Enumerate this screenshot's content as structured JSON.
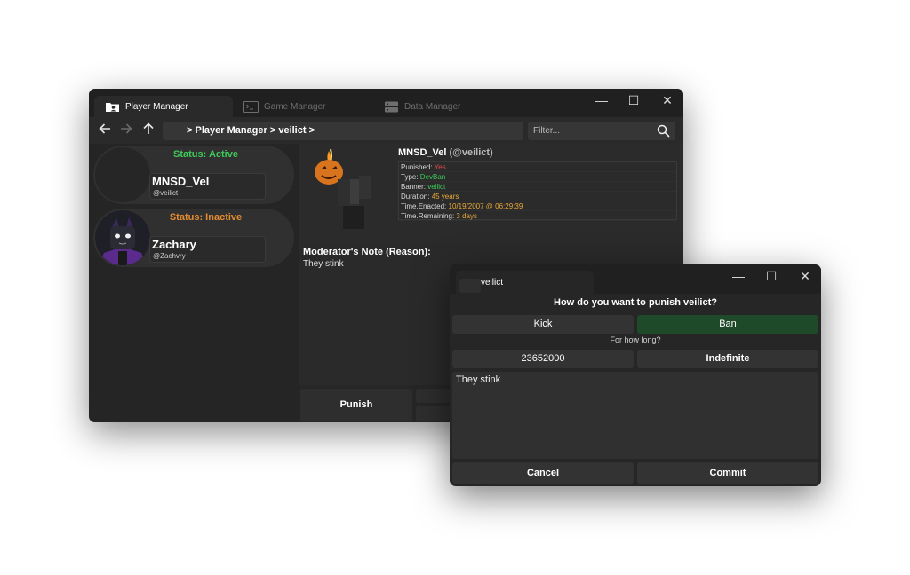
{
  "main_window": {
    "tabs": [
      {
        "label": "Player Manager",
        "icon": "player-folder-icon"
      },
      {
        "label": "Game Manager",
        "icon": "terminal-icon"
      },
      {
        "label": "Data Manager",
        "icon": "database-icon"
      }
    ],
    "controls": {
      "minimize": "—",
      "maximize": "☐",
      "close": "✕"
    },
    "path": "> Player Manager > veilict >",
    "filter_placeholder": "Filter...",
    "players": [
      {
        "status": "Status: Active",
        "status_color": "#3ec95a",
        "name": "MNSD_Vel",
        "handle": "@veilict"
      },
      {
        "status": "Status: Inactive",
        "status_color": "#e38b2f",
        "name": "Zachary",
        "handle": "@Zachvry"
      }
    ],
    "detail": {
      "name": "MNSD_Vel",
      "handle": "(@veilict)",
      "rows": [
        {
          "label": "Punished: ",
          "value": "Yes",
          "color": "#e04a4a"
        },
        {
          "label": "Type: ",
          "value": "DevBan",
          "color": "#3ec95a"
        },
        {
          "label": "Banner: ",
          "value": "veilict",
          "color": "#3ec95a"
        },
        {
          "label": "Duration: ",
          "value": "45 years",
          "color": "#e9a83a"
        },
        {
          "label": "Time.Enacted: ",
          "value": "10/19/2007 @ 06:29:39",
          "color": "#e9a83a"
        },
        {
          "label": "Time.Remaining: ",
          "value": "3 days",
          "color": "#e9a83a"
        }
      ],
      "note_title": "Moderator's Note (Reason):",
      "note_text": "They stink"
    },
    "punish_button": "Punish"
  },
  "dialog": {
    "tab_label": "veilict",
    "question": "How do you want to punish veilict?",
    "kick": "Kick",
    "ban": "Ban",
    "for_how_long": "For how long?",
    "duration_value": "23652000",
    "indefinite": "Indefinite",
    "reason": "They stink",
    "cancel": "Cancel",
    "commit": "Commit",
    "selected_color": "#1e4a2a"
  }
}
